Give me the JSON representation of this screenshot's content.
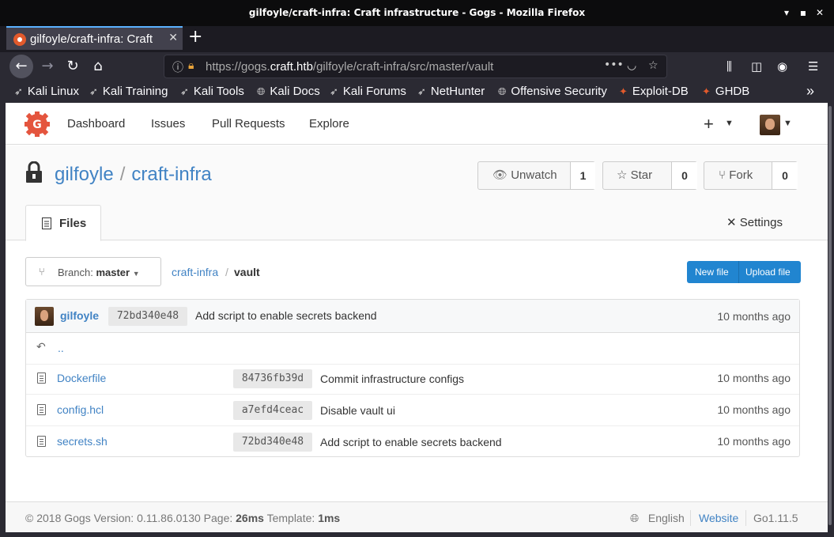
{
  "window": {
    "title": "gilfoyle/craft-infra: Craft infrastructure - Gogs - Mozilla Firefox"
  },
  "tab": {
    "label": "gilfoyle/craft-infra: Craft infrastructure - Gogs"
  },
  "url": {
    "prefix": "https://gogs.",
    "host": "craft.htb",
    "path": "/gilfoyle/craft-infra/src/master/vault"
  },
  "bookmarks": [
    {
      "label": "Kali Linux"
    },
    {
      "label": "Kali Training"
    },
    {
      "label": "Kali Tools"
    },
    {
      "label": "Kali Docs"
    },
    {
      "label": "Kali Forums"
    },
    {
      "label": "NetHunter"
    },
    {
      "label": "Offensive Security"
    },
    {
      "label": "Exploit-DB"
    },
    {
      "label": "GHDB"
    }
  ],
  "nav": {
    "dashboard": "Dashboard",
    "issues": "Issues",
    "pulls": "Pull Requests",
    "explore": "Explore"
  },
  "repo": {
    "owner": "gilfoyle",
    "sep": "/",
    "name": "craft-infra",
    "unwatch": "Unwatch",
    "watch_count": "1",
    "star": "Star",
    "star_count": "0",
    "fork": "Fork",
    "fork_count": "0",
    "files_tab": "Files",
    "settings_tab": "Settings"
  },
  "branch": {
    "label": "Branch:",
    "value": "master"
  },
  "breadcrumb": {
    "root": "craft-infra",
    "sep": "/",
    "current": "vault"
  },
  "buttons": {
    "new_file": "New file",
    "upload_file": "Upload file"
  },
  "latest_commit": {
    "author": "gilfoyle",
    "sha": "72bd340e48",
    "message": "Add script to enable secrets backend",
    "time": "10 months ago"
  },
  "parent": "..",
  "files": [
    {
      "name": "Dockerfile",
      "sha": "84736fb39d",
      "message": "Commit infrastructure configs",
      "time": "10 months ago"
    },
    {
      "name": "config.hcl",
      "sha": "a7efd4ceac",
      "message": "Disable vault ui",
      "time": "10 months ago"
    },
    {
      "name": "secrets.sh",
      "sha": "72bd340e48",
      "message": "Add script to enable secrets backend",
      "time": "10 months ago"
    }
  ],
  "footer": {
    "copyright": "© 2018 Gogs Version: 0.11.86.0130 Page: ",
    "page_time": "26ms",
    "template_label": " Template: ",
    "template_time": "1ms",
    "language": "English",
    "website": "Website",
    "go": "Go1.11.5"
  },
  "colors": {
    "link": "#4183c4",
    "primary": "#2185d0",
    "tab_accent": "#5bb1ff"
  }
}
